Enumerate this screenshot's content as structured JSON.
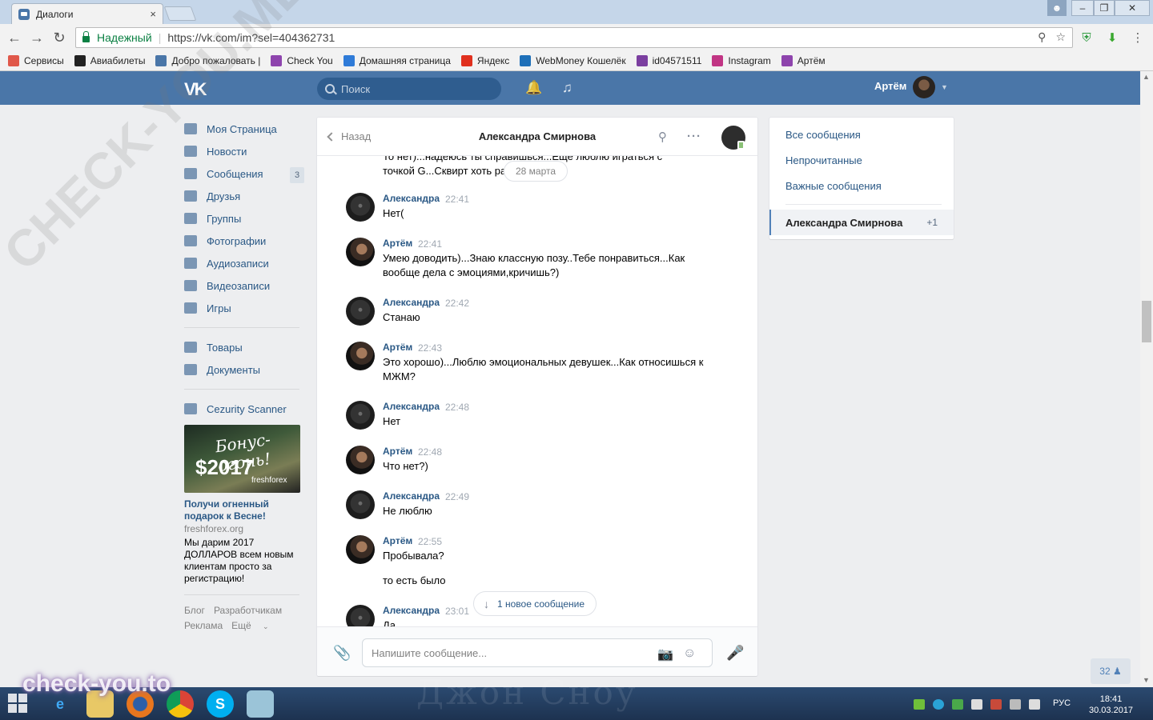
{
  "browser": {
    "tab_title": "Диалоги",
    "tab_close": "×",
    "secure_label": "Надежный",
    "url": "https://vk.com/im?sel=404362731",
    "bookmarks": [
      {
        "label": "Сервисы",
        "color": "#e0584a"
      },
      {
        "label": "Авиабилеты",
        "color": "#222222"
      },
      {
        "label": "Добро пожаловать |",
        "color": "#4a76a8"
      },
      {
        "label": "Check You",
        "color": "#8e44ad"
      },
      {
        "label": "Домашняя страница",
        "color": "#2f7bd8"
      },
      {
        "label": "Яндекс",
        "color": "#e0301e"
      },
      {
        "label": "WebMoney Кошелёк",
        "color": "#1d6fb8"
      },
      {
        "label": "id04571511",
        "color": "#7b3fa0"
      },
      {
        "label": "Instagram",
        "color": "#c13584"
      },
      {
        "label": "Артём",
        "color": "#8e44ad"
      }
    ]
  },
  "vk": {
    "search_placeholder": "Поиск",
    "user_name": "Артём",
    "nav": [
      {
        "label": "Моя Страница",
        "icon": "home-icon"
      },
      {
        "label": "Новости",
        "icon": "news-icon"
      },
      {
        "label": "Сообщения",
        "icon": "messages-icon",
        "badge": "3"
      },
      {
        "label": "Друзья",
        "icon": "friends-icon"
      },
      {
        "label": "Группы",
        "icon": "groups-icon"
      },
      {
        "label": "Фотографии",
        "icon": "photos-icon"
      },
      {
        "label": "Аудиозаписи",
        "icon": "audio-icon"
      },
      {
        "label": "Видеозаписи",
        "icon": "video-icon"
      },
      {
        "label": "Игры",
        "icon": "games-icon"
      }
    ],
    "nav2": [
      {
        "label": "Товары",
        "icon": "goods-icon"
      },
      {
        "label": "Документы",
        "icon": "documents-icon"
      }
    ],
    "nav3": [
      {
        "label": "Cezurity Scanner",
        "icon": "app-icon"
      }
    ],
    "ad": {
      "image_title": "Бонус-огонь!",
      "image_sum": "$2017",
      "image_brand": "freshforex",
      "headline": "Получи огненный подарок к Весне!",
      "domain": "freshforex.org",
      "text": "Мы дарим 2017 ДОЛЛАРОВ всем новым клиентам просто за регистрацию!"
    },
    "footer": [
      "Блог",
      "Разработчикам",
      "Реклама",
      "Ещё"
    ]
  },
  "chat": {
    "back_label": "Назад",
    "title": "Александра Смирнова",
    "partial_text": "То нет)...надеюсь ты справишься...Еще люблю играться с точкой G...Сквирт хоть ра",
    "date_pill": "28 марта",
    "messages": [
      {
        "author": "Александра",
        "time": "22:41",
        "text": "Нет(",
        "who": "her"
      },
      {
        "author": "Артём",
        "time": "22:41",
        "text": "Умею доводить)...Знаю классную позу..Тебе понравиться...Как вообще дела с эмоциями,кричишь?)",
        "who": "him"
      },
      {
        "author": "Александра",
        "time": "22:42",
        "text": "Станаю",
        "who": "her"
      },
      {
        "author": "Артём",
        "time": "22:43",
        "text": "Это хорошо)...Люблю эмоциональных девушек...Как относишься к МЖМ?",
        "who": "him"
      },
      {
        "author": "Александра",
        "time": "22:48",
        "text": "Нет",
        "who": "her"
      },
      {
        "author": "Артём",
        "time": "22:48",
        "text": "Что нет?)",
        "who": "him"
      },
      {
        "author": "Александра",
        "time": "22:49",
        "text": "Не люблю",
        "who": "her"
      },
      {
        "author": "Артём",
        "time": "22:55",
        "text": "Пробывала?",
        "text2": "то есть было",
        "who": "him"
      },
      {
        "author": "Александра",
        "time": "23:01",
        "text": "Да",
        "who": "her"
      }
    ],
    "new_message_label": "1 новое сообщение",
    "input_placeholder": "Напишите сообщение..."
  },
  "right_menu": {
    "items": [
      "Все сообщения",
      "Непрочитанные",
      "Важные сообщения"
    ],
    "active_name": "Александра Смирнова",
    "active_count": "+1"
  },
  "widget_count": "32",
  "taskbar": {
    "lang": "РУС",
    "time": "18:41",
    "date": "30.03.2017",
    "bg_text": "Джон Сноу"
  },
  "watermarks": {
    "diagonal": "CHECK-YOU.ME",
    "bottom": "check-you.to"
  }
}
